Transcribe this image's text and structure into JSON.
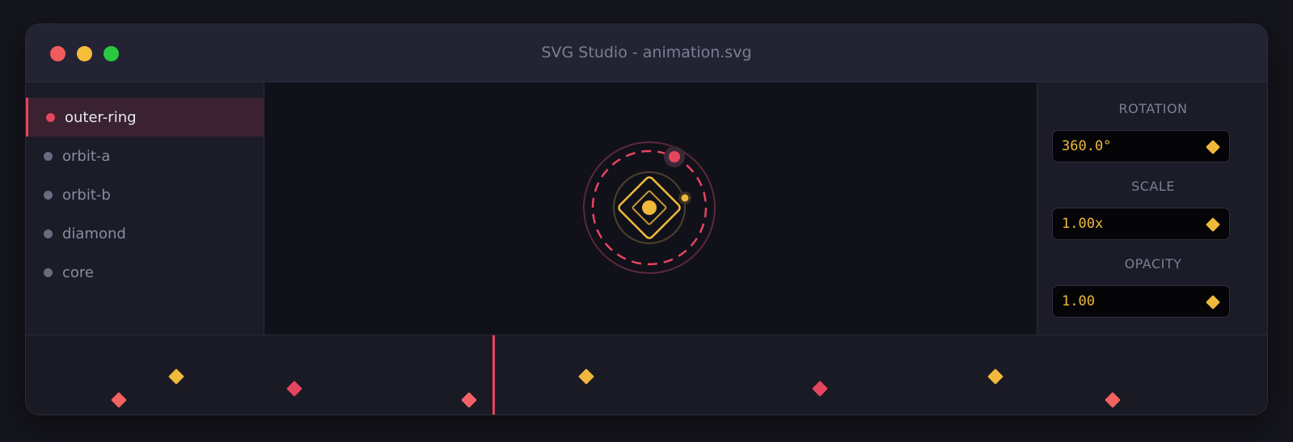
{
  "window": {
    "title": "SVG Studio - animation.svg"
  },
  "layers": [
    {
      "label": "outer-ring",
      "active": true
    },
    {
      "label": "orbit-a",
      "active": false
    },
    {
      "label": "orbit-b",
      "active": false
    },
    {
      "label": "diamond",
      "active": false
    },
    {
      "label": "core",
      "active": false
    }
  ],
  "properties": {
    "rotation": {
      "label": "ROTATION",
      "value": "360.0°"
    },
    "scale": {
      "label": "SCALE",
      "value": "1.00x"
    },
    "opacity": {
      "label": "OPACITY",
      "value": "1.00"
    }
  },
  "colors": {
    "accent_red": "#e64560",
    "accent_yellow": "#f0b93b",
    "keyframe_coral": "#f26262"
  },
  "icons": {
    "keyframe": "diamond-icon",
    "window_controls": [
      "close-dot",
      "minimize-dot",
      "zoom-dot"
    ]
  }
}
